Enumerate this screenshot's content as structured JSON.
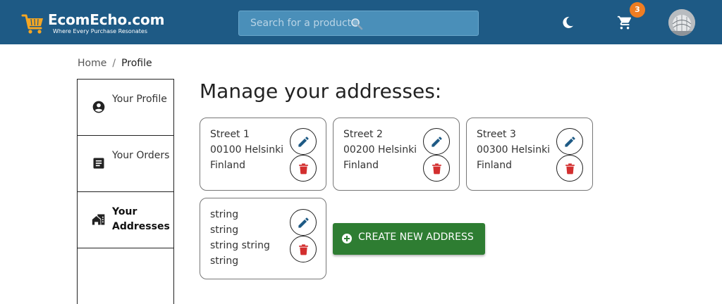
{
  "header": {
    "logo_title": "EcomEcho.com",
    "logo_tagline": "Where Every Purchase Resonates",
    "search_placeholder": "Search for a product",
    "cart_count": "3",
    "icons": [
      "cart-logo-icon",
      "search-icon",
      "moon-icon",
      "cart-icon",
      "avatar"
    ],
    "colors": {
      "bar": "#1e5a85",
      "badge": "#ef7d22"
    }
  },
  "breadcrumb": {
    "home": "Home",
    "separator": "/",
    "current": "Profile"
  },
  "sidebar": {
    "items": [
      {
        "label": "Your Profile",
        "icon": "account-circle-icon"
      },
      {
        "label": "Your Orders",
        "icon": "list-alt-icon"
      },
      {
        "label": "Your Addresses",
        "icon": "home-work-icon",
        "active": true
      }
    ]
  },
  "main": {
    "title": "Manage your addresses:",
    "addresses": [
      {
        "lines": [
          "Street 1",
          "00100 Helsinki",
          "Finland"
        ]
      },
      {
        "lines": [
          "Street 2",
          "00200 Helsinki",
          "Finland"
        ]
      },
      {
        "lines": [
          "Street 3",
          "00300 Helsinki",
          "Finland"
        ]
      },
      {
        "lines": [
          "string",
          "string",
          "string string",
          "string"
        ]
      }
    ],
    "create_button_label": "CREATE NEW ADDRESS",
    "colors": {
      "edit": "#1e5a85",
      "delete": "#d32f2f",
      "create": "#2e7d32"
    }
  }
}
